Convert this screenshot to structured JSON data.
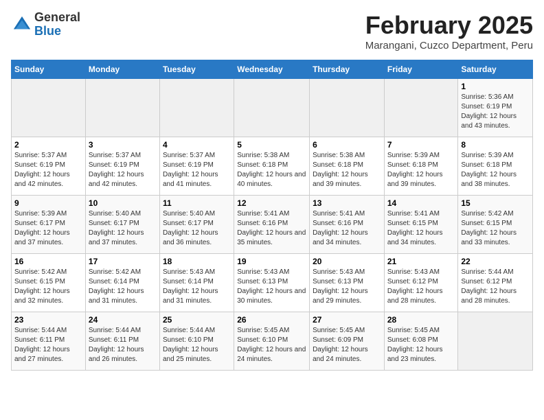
{
  "logo": {
    "general": "General",
    "blue": "Blue"
  },
  "title": "February 2025",
  "subtitle": "Marangani, Cuzco Department, Peru",
  "days_of_week": [
    "Sunday",
    "Monday",
    "Tuesday",
    "Wednesday",
    "Thursday",
    "Friday",
    "Saturday"
  ],
  "weeks": [
    [
      {
        "day": "",
        "info": ""
      },
      {
        "day": "",
        "info": ""
      },
      {
        "day": "",
        "info": ""
      },
      {
        "day": "",
        "info": ""
      },
      {
        "day": "",
        "info": ""
      },
      {
        "day": "",
        "info": ""
      },
      {
        "day": "1",
        "info": "Sunrise: 5:36 AM\nSunset: 6:19 PM\nDaylight: 12 hours and 43 minutes."
      }
    ],
    [
      {
        "day": "2",
        "info": "Sunrise: 5:37 AM\nSunset: 6:19 PM\nDaylight: 12 hours and 42 minutes."
      },
      {
        "day": "3",
        "info": "Sunrise: 5:37 AM\nSunset: 6:19 PM\nDaylight: 12 hours and 42 minutes."
      },
      {
        "day": "4",
        "info": "Sunrise: 5:37 AM\nSunset: 6:19 PM\nDaylight: 12 hours and 41 minutes."
      },
      {
        "day": "5",
        "info": "Sunrise: 5:38 AM\nSunset: 6:18 PM\nDaylight: 12 hours and 40 minutes."
      },
      {
        "day": "6",
        "info": "Sunrise: 5:38 AM\nSunset: 6:18 PM\nDaylight: 12 hours and 39 minutes."
      },
      {
        "day": "7",
        "info": "Sunrise: 5:39 AM\nSunset: 6:18 PM\nDaylight: 12 hours and 39 minutes."
      },
      {
        "day": "8",
        "info": "Sunrise: 5:39 AM\nSunset: 6:18 PM\nDaylight: 12 hours and 38 minutes."
      }
    ],
    [
      {
        "day": "9",
        "info": "Sunrise: 5:39 AM\nSunset: 6:17 PM\nDaylight: 12 hours and 37 minutes."
      },
      {
        "day": "10",
        "info": "Sunrise: 5:40 AM\nSunset: 6:17 PM\nDaylight: 12 hours and 37 minutes."
      },
      {
        "day": "11",
        "info": "Sunrise: 5:40 AM\nSunset: 6:17 PM\nDaylight: 12 hours and 36 minutes."
      },
      {
        "day": "12",
        "info": "Sunrise: 5:41 AM\nSunset: 6:16 PM\nDaylight: 12 hours and 35 minutes."
      },
      {
        "day": "13",
        "info": "Sunrise: 5:41 AM\nSunset: 6:16 PM\nDaylight: 12 hours and 34 minutes."
      },
      {
        "day": "14",
        "info": "Sunrise: 5:41 AM\nSunset: 6:15 PM\nDaylight: 12 hours and 34 minutes."
      },
      {
        "day": "15",
        "info": "Sunrise: 5:42 AM\nSunset: 6:15 PM\nDaylight: 12 hours and 33 minutes."
      }
    ],
    [
      {
        "day": "16",
        "info": "Sunrise: 5:42 AM\nSunset: 6:15 PM\nDaylight: 12 hours and 32 minutes."
      },
      {
        "day": "17",
        "info": "Sunrise: 5:42 AM\nSunset: 6:14 PM\nDaylight: 12 hours and 31 minutes."
      },
      {
        "day": "18",
        "info": "Sunrise: 5:43 AM\nSunset: 6:14 PM\nDaylight: 12 hours and 31 minutes."
      },
      {
        "day": "19",
        "info": "Sunrise: 5:43 AM\nSunset: 6:13 PM\nDaylight: 12 hours and 30 minutes."
      },
      {
        "day": "20",
        "info": "Sunrise: 5:43 AM\nSunset: 6:13 PM\nDaylight: 12 hours and 29 minutes."
      },
      {
        "day": "21",
        "info": "Sunrise: 5:43 AM\nSunset: 6:12 PM\nDaylight: 12 hours and 28 minutes."
      },
      {
        "day": "22",
        "info": "Sunrise: 5:44 AM\nSunset: 6:12 PM\nDaylight: 12 hours and 28 minutes."
      }
    ],
    [
      {
        "day": "23",
        "info": "Sunrise: 5:44 AM\nSunset: 6:11 PM\nDaylight: 12 hours and 27 minutes."
      },
      {
        "day": "24",
        "info": "Sunrise: 5:44 AM\nSunset: 6:11 PM\nDaylight: 12 hours and 26 minutes."
      },
      {
        "day": "25",
        "info": "Sunrise: 5:44 AM\nSunset: 6:10 PM\nDaylight: 12 hours and 25 minutes."
      },
      {
        "day": "26",
        "info": "Sunrise: 5:45 AM\nSunset: 6:10 PM\nDaylight: 12 hours and 24 minutes."
      },
      {
        "day": "27",
        "info": "Sunrise: 5:45 AM\nSunset: 6:09 PM\nDaylight: 12 hours and 24 minutes."
      },
      {
        "day": "28",
        "info": "Sunrise: 5:45 AM\nSunset: 6:08 PM\nDaylight: 12 hours and 23 minutes."
      },
      {
        "day": "",
        "info": ""
      }
    ]
  ]
}
